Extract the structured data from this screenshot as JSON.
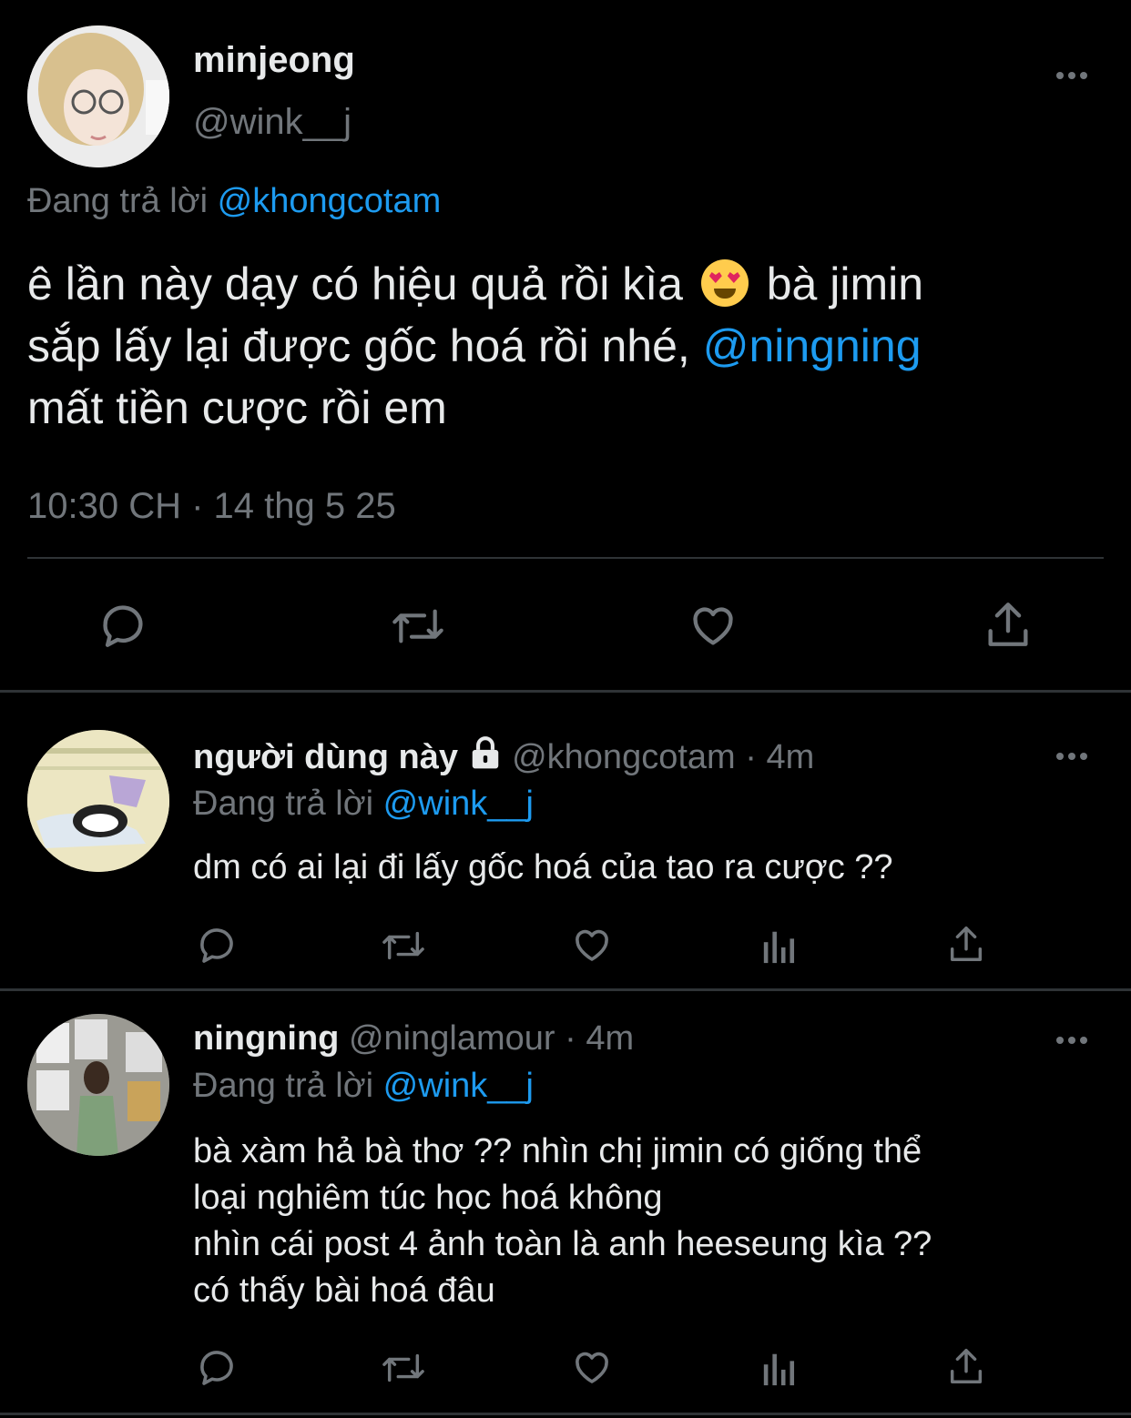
{
  "main_tweet": {
    "name": "minjeong",
    "handle": "@wink__j",
    "reply_prefix": "Đang trả lời",
    "reply_to": "@khongcotam",
    "text_part1": "ê lần này dạy có hiệu quả rồi kìa",
    "text_part2": "bà jimin",
    "text_part3": "sắp lấy lại được gốc hoá rồi nhé,",
    "text_mention": "@ningning",
    "text_part4": "mất tiền cược rồi em",
    "emoji": "heart-eyes-emoji",
    "timestamp": "10:30 CH · 14 thg 5 25"
  },
  "replies": [
    {
      "name": "người dùng này",
      "locked": true,
      "handle": "@khongcotam",
      "time_sep": "·",
      "time": "4m",
      "reply_prefix": "Đang trả lời",
      "reply_to": "@wink__j",
      "text": "dm có ai lại đi lấy gốc hoá của tao ra cược ??"
    },
    {
      "name": "ningning",
      "locked": false,
      "handle": "@ninglamour",
      "time_sep": "·",
      "time": "4m",
      "reply_prefix": "Đang trả lời",
      "reply_to": "@wink__j",
      "text_lines": [
        "bà xàm hả bà thơ ?? nhìn chị jimin có giống thể",
        "loại nghiêm túc học hoá không",
        "nhìn cái post 4 ảnh toàn là anh heeseung kìa ??",
        "có thấy bài hoá đâu"
      ]
    }
  ],
  "icons": {
    "reply": "comment-icon",
    "retweet": "retweet-icon",
    "like": "heart-icon",
    "views": "analytics-icon",
    "share": "share-icon",
    "more": "more-icon",
    "lock": "lock-icon"
  },
  "colors": {
    "background": "#000000",
    "text": "#e7e9ea",
    "muted": "#71767b",
    "link": "#1d9bf0",
    "divider": "#2f3336"
  }
}
